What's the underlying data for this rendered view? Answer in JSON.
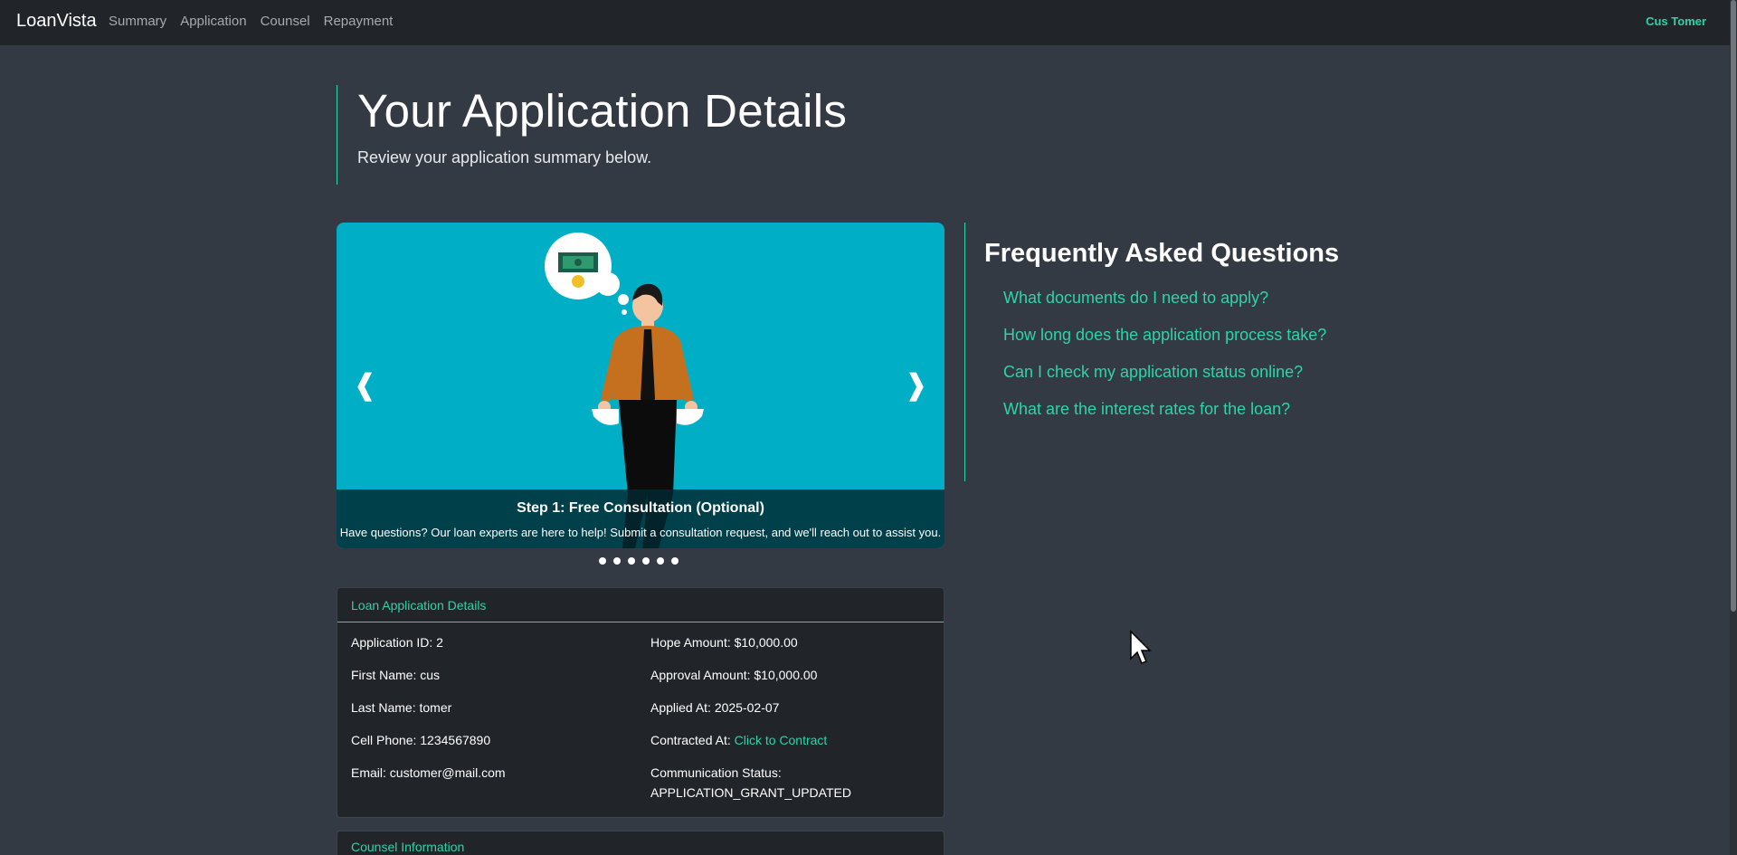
{
  "navbar": {
    "brand": "LoanVista",
    "links": [
      "Summary",
      "Application",
      "Counsel",
      "Repayment"
    ],
    "user": "Cus Tomer"
  },
  "header": {
    "title": "Your Application Details",
    "subtitle": "Review your application summary below."
  },
  "carousel": {
    "prev_icon": "chevron-left-icon",
    "next_icon": "chevron-right-icon",
    "prev_glyph": "❰",
    "next_glyph": "❱",
    "caption_title": "Step 1: Free Consultation (Optional)",
    "caption_text": "Have questions? Our loan experts are here to help! Submit a consultation request, and we'll reach out to assist you.",
    "slide_count": 6
  },
  "faq": {
    "title": "Frequently Asked Questions",
    "items": [
      "What documents do I need to apply?",
      "How long does the application process take?",
      "Can I check my application status online?",
      "What are the interest rates for the loan?"
    ]
  },
  "loan_details": {
    "header": "Loan Application Details",
    "application_id": "Application ID: 2",
    "first_name": "First Name: cus",
    "last_name": "Last Name: tomer",
    "cell_phone": "Cell Phone: 1234567890",
    "email": "Email: customer@mail.com",
    "hope_amount": "Hope Amount: $10,000.00",
    "approval_amount": "Approval Amount: $10,000.00",
    "applied_at": "Applied At: 2025-02-07",
    "contracted_at_label": "Contracted At: ",
    "contracted_at_link": "Click to Contract",
    "communication_status_label": "Communication Status:",
    "communication_status_value": "APPLICATION_GRANT_UPDATED"
  },
  "counsel": {
    "header": "Counsel Information"
  },
  "colors": {
    "accent": "#2ed3a8",
    "background": "#343a43",
    "navbar": "#212529",
    "carousel_bg": "#00aec6"
  }
}
